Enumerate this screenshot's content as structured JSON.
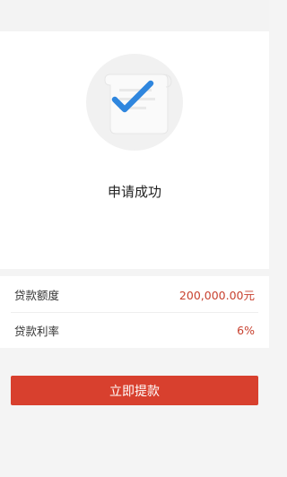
{
  "status": {
    "title": "申请成功",
    "icon": "check-document-icon"
  },
  "loan_details": [
    {
      "label": "贷款额度",
      "value": "200,000.00元"
    },
    {
      "label": "贷款利率",
      "value": "6%"
    }
  ],
  "actions": {
    "withdraw_label": "立即提款"
  },
  "colors": {
    "accent": "#d8402e",
    "value_text": "#c8412f",
    "check": "#2f86de"
  }
}
